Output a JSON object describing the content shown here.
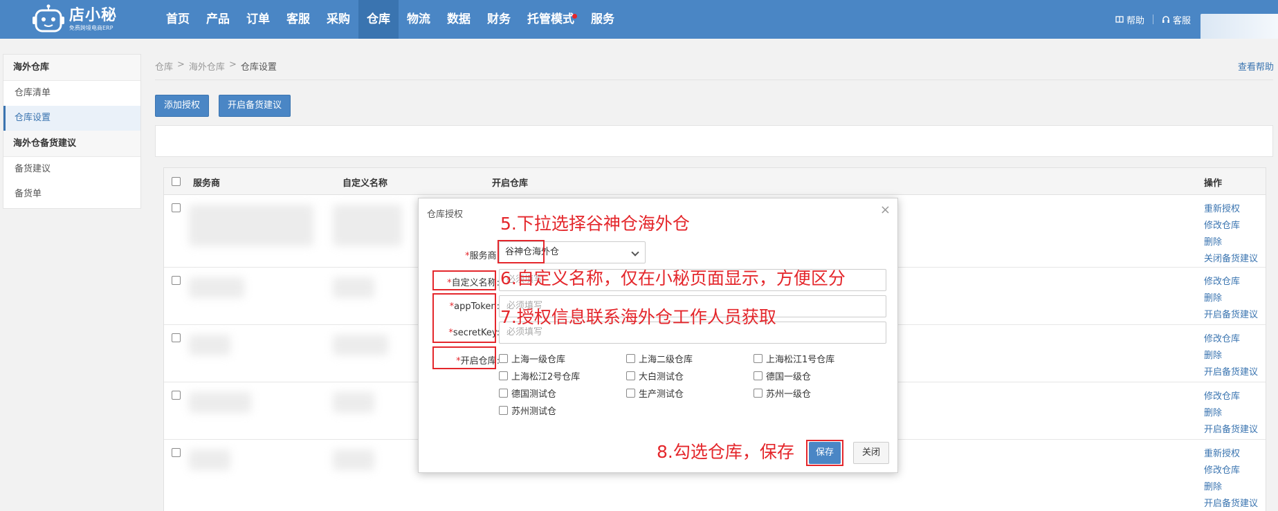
{
  "header": {
    "logo": {
      "name": "店小秘",
      "tagline": "免费跨境电商ERP"
    },
    "nav": [
      {
        "label": "首页"
      },
      {
        "label": "产品"
      },
      {
        "label": "订单"
      },
      {
        "label": "客服"
      },
      {
        "label": "采购"
      },
      {
        "label": "仓库",
        "active": true
      },
      {
        "label": "物流"
      },
      {
        "label": "数据"
      },
      {
        "label": "财务"
      },
      {
        "label": "托管模式",
        "badge_dot": true
      },
      {
        "label": "服务"
      }
    ],
    "help_label": "帮助",
    "service_label": "客服"
  },
  "sidebar": {
    "group1": "海外仓库",
    "items1": [
      "仓库清单",
      "仓库设置"
    ],
    "group2": "海外仓备货建议",
    "items2": [
      "备货建议",
      "备货单"
    ]
  },
  "breadcrumb": {
    "a": "仓库",
    "b": "海外仓库",
    "current": "仓库设置"
  },
  "help_link": "查看帮助",
  "actions": {
    "add_auth": "添加授权",
    "enable_stock": "开启备货建议"
  },
  "table": {
    "columns": {
      "provider": "服务商",
      "custom_name": "自定义名称",
      "warehouses": "开启仓库",
      "ops": "操作"
    },
    "rows": [
      {
        "ops": [
          "重新授权",
          "修改仓库",
          "删除",
          "关闭备货建议"
        ]
      },
      {
        "ops": [
          "修改仓库",
          "删除",
          "开启备货建议"
        ]
      },
      {
        "ops": [
          "修改仓库",
          "删除",
          "开启备货建议"
        ]
      },
      {
        "ops": [
          "修改仓库",
          "删除",
          "开启备货建议"
        ]
      },
      {
        "ops": [
          "重新授权",
          "修改仓库",
          "删除",
          "开启备货建议"
        ]
      }
    ]
  },
  "modal": {
    "title": "仓库授权",
    "close_glyph": "×",
    "fields": {
      "provider": {
        "label": "服务商:",
        "value": "谷神仓海外仓"
      },
      "custom_name": {
        "label": "自定义名称:",
        "placeholder": "必须填写"
      },
      "app_token": {
        "label": "appToken:",
        "placeholder": "必须填写"
      },
      "secret_key": {
        "label": "secretKey:",
        "placeholder": "必须填写"
      },
      "warehouses": {
        "label": "开启仓库:"
      }
    },
    "required_mark": "*",
    "warehouses": [
      "上海一级仓库",
      "上海二级仓库",
      "上海松江1号仓库",
      "上海松江2号仓库",
      "大白测试仓",
      "德国一级仓",
      "德国测试仓",
      "生产测试仓",
      "苏州一级仓",
      "苏州测试仓"
    ],
    "save": "保存",
    "close": "关闭"
  },
  "annotations": {
    "step5": "5.下拉选择谷神仓海外仓",
    "step6": "6.自定义名称，仅在小秘页面显示，方便区分",
    "step7": "7.授权信息联系海外仓工作人员获取",
    "step8": "8.勾选仓库，保存"
  },
  "colors": {
    "primary": "#4a86c5",
    "annotation": "#e4262b"
  }
}
